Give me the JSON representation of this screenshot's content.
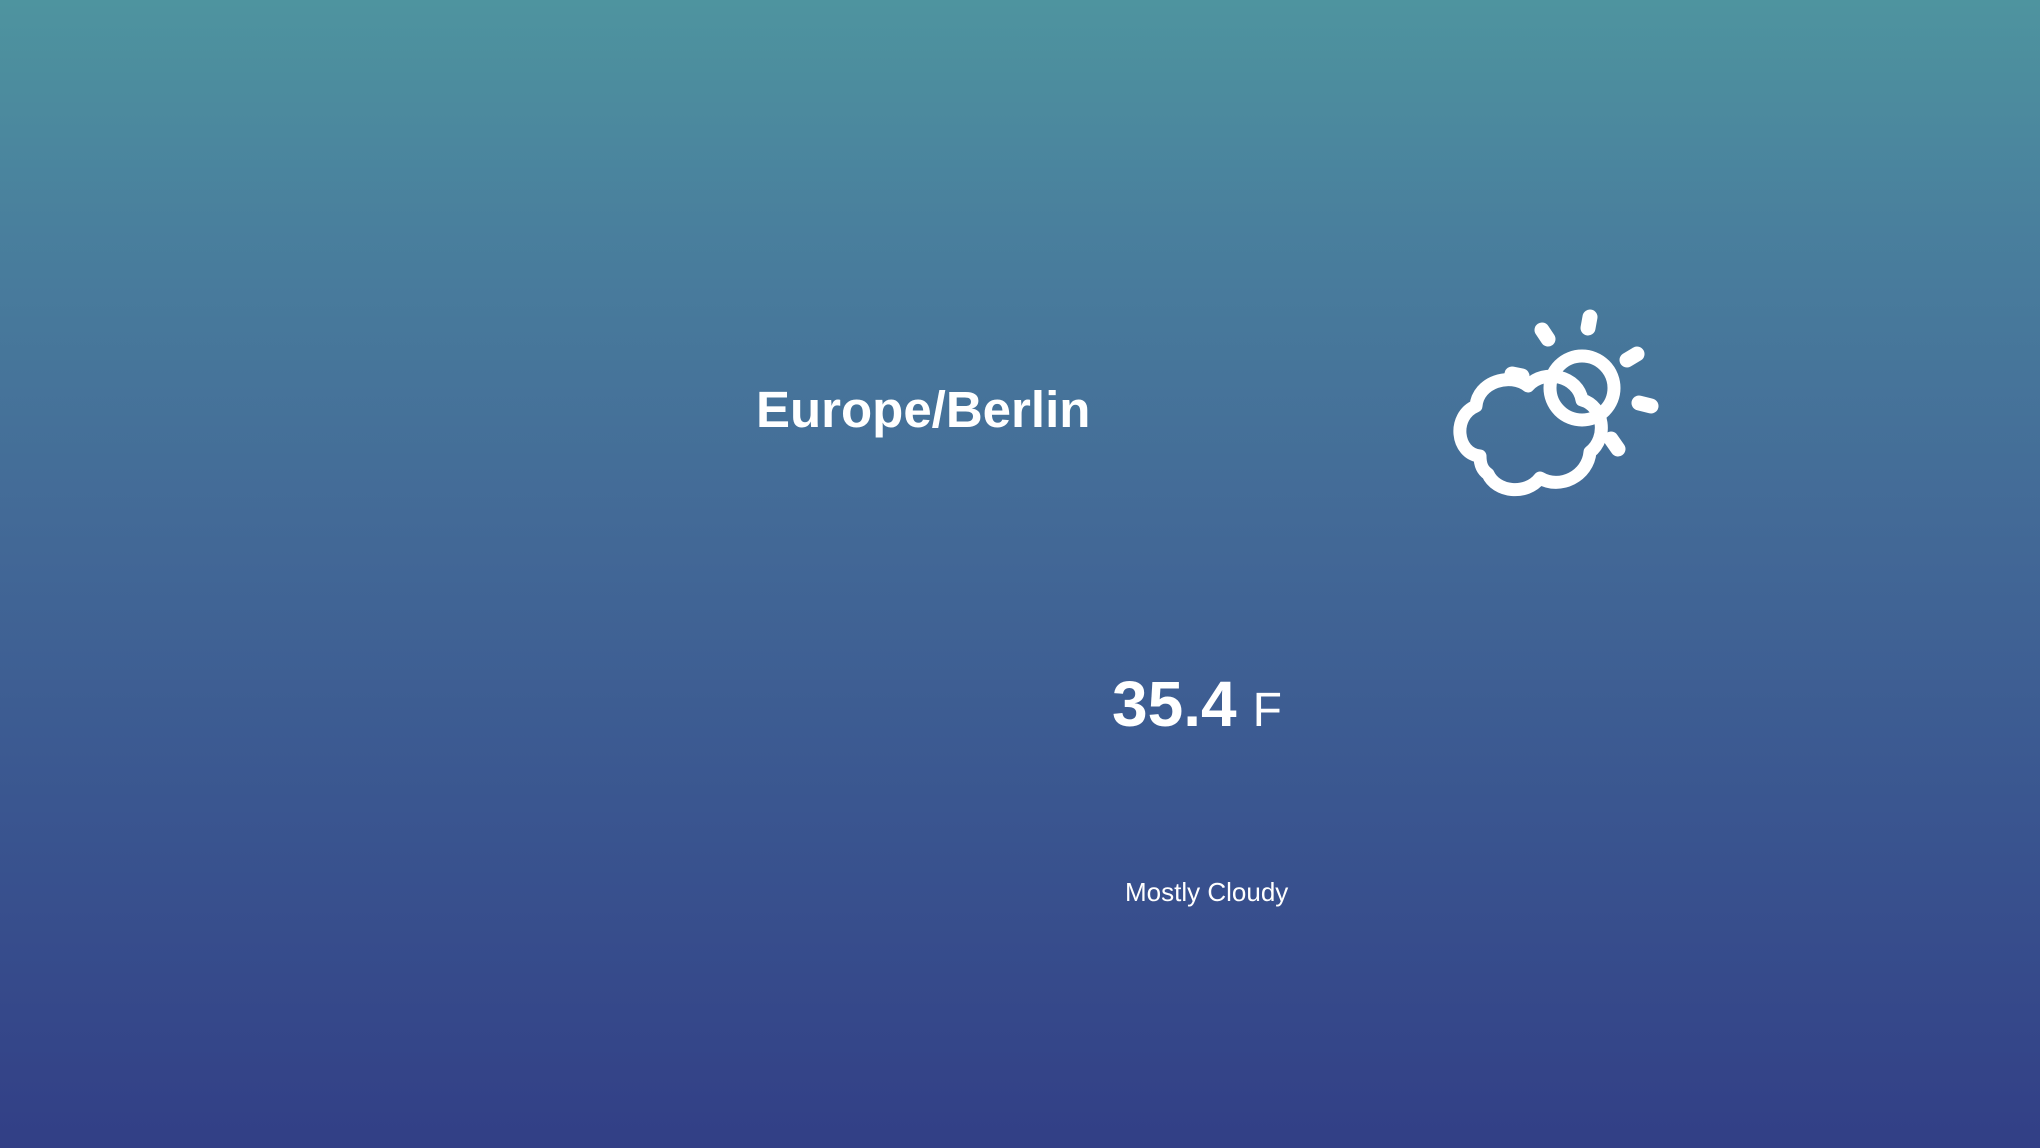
{
  "location": {
    "timezone": "Europe/Berlin"
  },
  "current": {
    "temperature": "35.4",
    "unit": "F",
    "summary": "Mostly Cloudy",
    "icon": "partly-cloudy-day-icon"
  },
  "colors": {
    "gradient_top": "#4e949f",
    "gradient_bottom": "#323f86",
    "text": "#ffffff"
  }
}
